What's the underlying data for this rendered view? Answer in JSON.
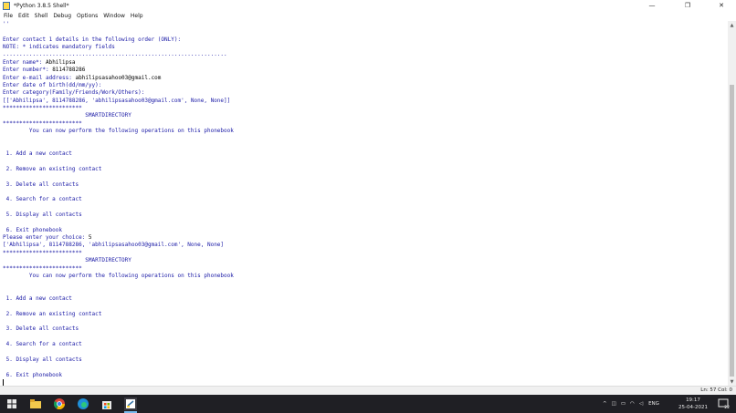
{
  "window": {
    "title": "*Python 3.8.5 Shell*",
    "controls": {
      "minimize": "—",
      "restore": "❐",
      "close": "✕"
    }
  },
  "menu": [
    "File",
    "Edit",
    "Shell",
    "Debug",
    "Options",
    "Window",
    "Help"
  ],
  "shell_lines": [
    {
      "text": "''",
      "kind": "out"
    },
    {
      "text": "",
      "kind": "out"
    },
    {
      "text": "Enter contact 1 details in the following order (ONLY):",
      "kind": "out"
    },
    {
      "text": "NOTE: * indicates mandatory fields",
      "kind": "out"
    },
    {
      "text": "....................................................................",
      "kind": "out"
    },
    {
      "text": "Enter name*: ",
      "kind": "out",
      "input": "Abhilipsa"
    },
    {
      "text": "Enter number*: ",
      "kind": "out",
      "input": "8114788286"
    },
    {
      "text": "Enter e-mail address: ",
      "kind": "out",
      "input": "abhilipsasahoo03@gmail.com"
    },
    {
      "text": "Enter date of birth(dd/mm/yy):",
      "kind": "out"
    },
    {
      "text": "Enter category(Family/Friends/Work/Others):",
      "kind": "out"
    },
    {
      "text": "[['Abhilipsa', 8114788286, 'abhilipsasahoo03@gmail.com', None, None]]",
      "kind": "out"
    },
    {
      "text": "************************",
      "kind": "out"
    },
    {
      "text": "                         SMARTDIRECTORY",
      "kind": "out"
    },
    {
      "text": "************************",
      "kind": "out"
    },
    {
      "text": "        You can now perform the following operations on this phonebook",
      "kind": "out"
    },
    {
      "text": "",
      "kind": "out"
    },
    {
      "text": "",
      "kind": "out"
    },
    {
      "text": " 1. Add a new contact",
      "kind": "out"
    },
    {
      "text": "",
      "kind": "out"
    },
    {
      "text": " 2. Remove an existing contact",
      "kind": "out"
    },
    {
      "text": "",
      "kind": "out"
    },
    {
      "text": " 3. Delete all contacts",
      "kind": "out"
    },
    {
      "text": "",
      "kind": "out"
    },
    {
      "text": " 4. Search for a contact",
      "kind": "out"
    },
    {
      "text": "",
      "kind": "out"
    },
    {
      "text": " 5. Display all contacts",
      "kind": "out"
    },
    {
      "text": "",
      "kind": "out"
    },
    {
      "text": " 6. Exit phonebook",
      "kind": "out"
    },
    {
      "text": "Please enter your choice: ",
      "kind": "out",
      "input": "5"
    },
    {
      "text": "['Abhilipsa', 8114788286, 'abhilipsasahoo03@gmail.com', None, None]",
      "kind": "out"
    },
    {
      "text": "************************",
      "kind": "out"
    },
    {
      "text": "                         SMARTDIRECTORY",
      "kind": "out"
    },
    {
      "text": "************************",
      "kind": "out"
    },
    {
      "text": "        You can now perform the following operations on this phonebook",
      "kind": "out"
    },
    {
      "text": "",
      "kind": "out"
    },
    {
      "text": "",
      "kind": "out"
    },
    {
      "text": " 1. Add a new contact",
      "kind": "out"
    },
    {
      "text": "",
      "kind": "out"
    },
    {
      "text": " 2. Remove an existing contact",
      "kind": "out"
    },
    {
      "text": "",
      "kind": "out"
    },
    {
      "text": " 3. Delete all contacts",
      "kind": "out"
    },
    {
      "text": "",
      "kind": "out"
    },
    {
      "text": " 4. Search for a contact",
      "kind": "out"
    },
    {
      "text": "",
      "kind": "out"
    },
    {
      "text": " 5. Display all contacts",
      "kind": "out"
    },
    {
      "text": "",
      "kind": "out"
    },
    {
      "text": " 6. Exit phonebook",
      "kind": "out"
    },
    {
      "text": "",
      "kind": "cursor"
    }
  ],
  "status": {
    "position": "Ln: 57  Col: 0"
  },
  "taskbar": {
    "icons": [
      "windows-start-icon",
      "file-explorer-icon",
      "chrome-icon",
      "edge-icon",
      "store-icon",
      "python-idle-icon"
    ],
    "language": "ENG",
    "time": "19:17",
    "date": "25-04-2021",
    "notification_count": "22"
  },
  "colors": {
    "shell_output": "#1a1aa6",
    "user_input": "#000000",
    "taskbar": "#1f1f24"
  }
}
